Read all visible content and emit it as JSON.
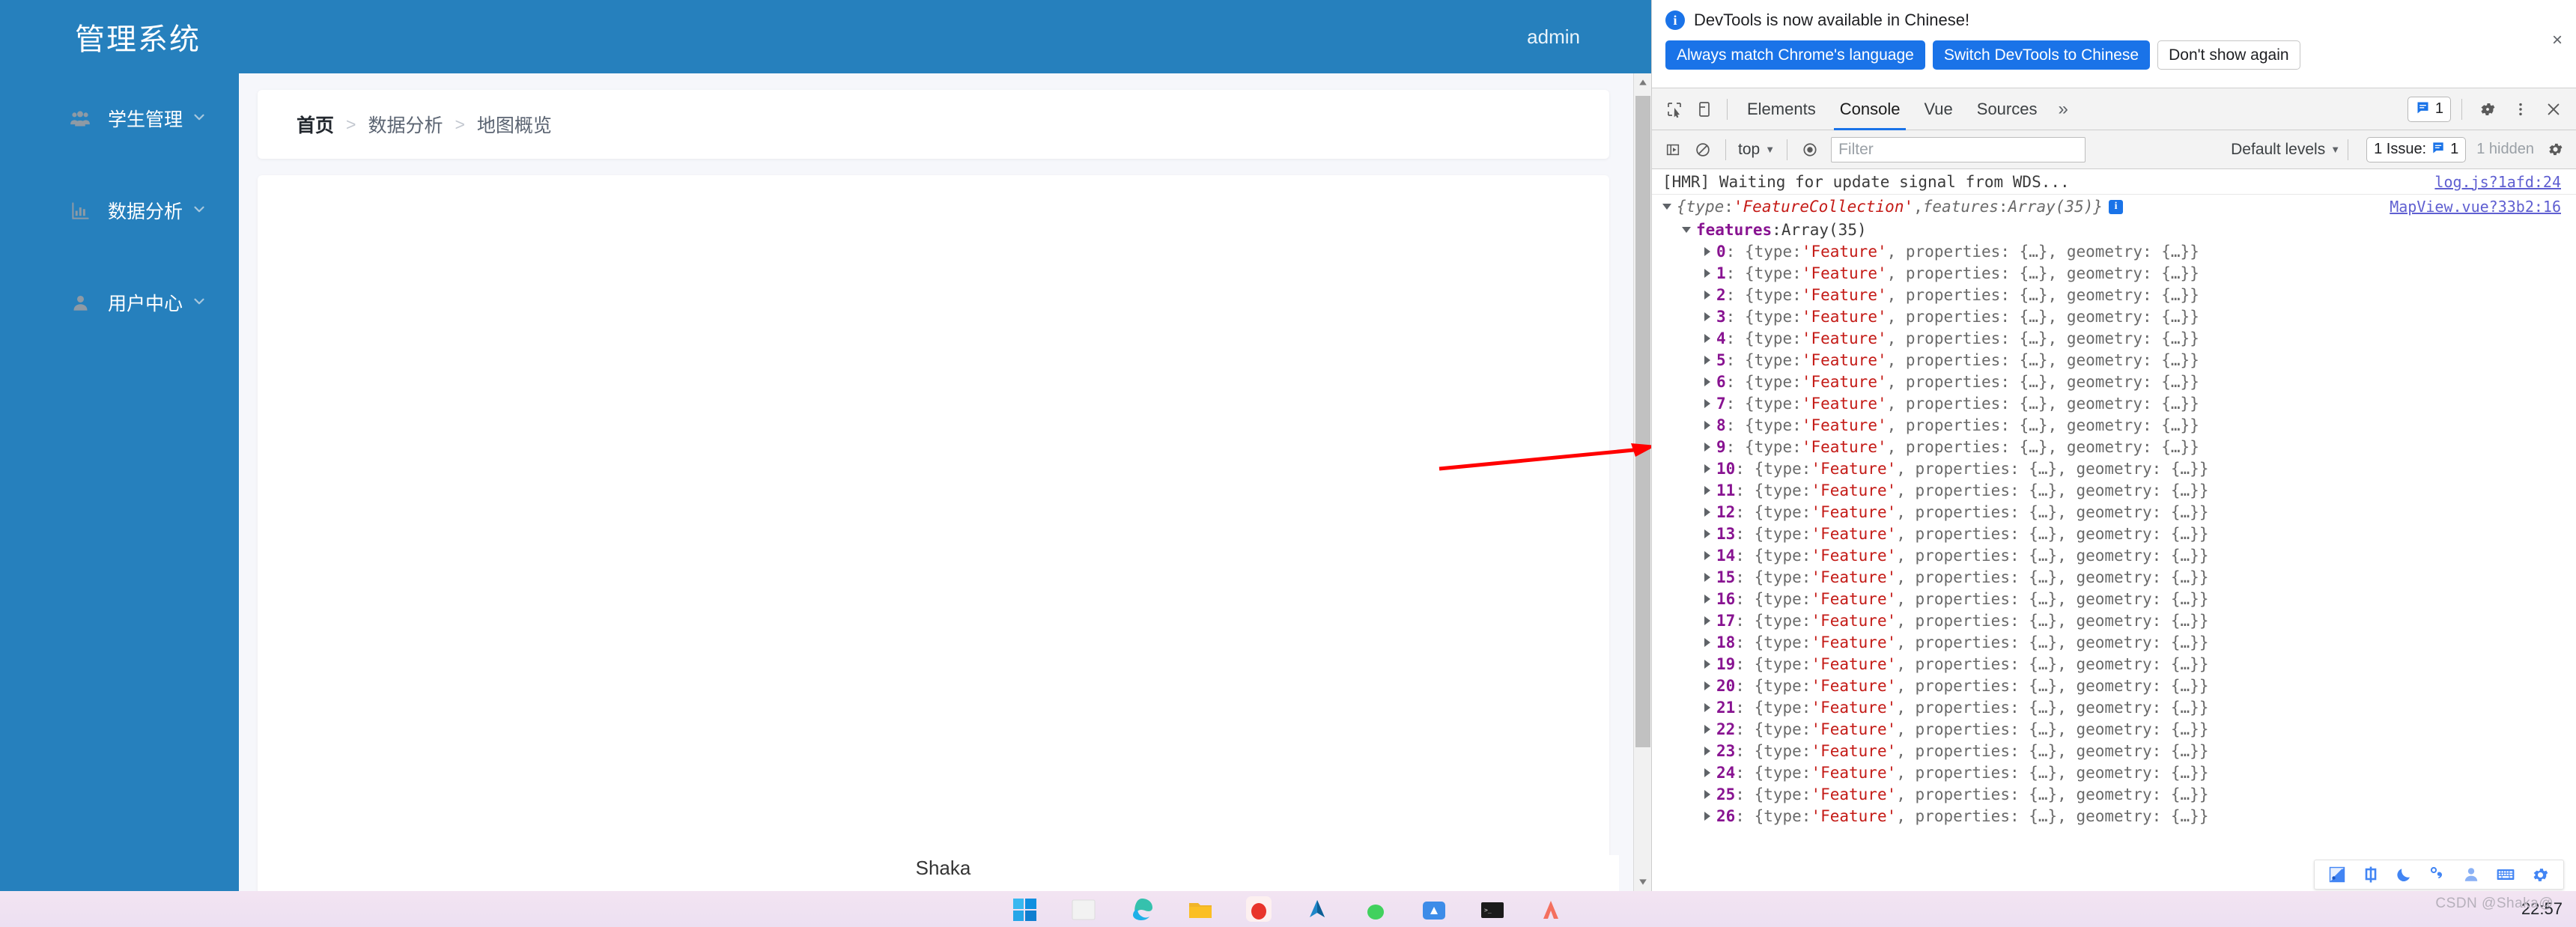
{
  "app": {
    "title": "管理系统",
    "user": "admin",
    "sidebar": {
      "items": [
        {
          "label": "学生管理",
          "icon": "users-icon",
          "arrow": "chevron-down-icon"
        },
        {
          "label": "数据分析",
          "icon": "bar-chart-icon",
          "arrow": "chevron-down-icon"
        },
        {
          "label": "用户中心",
          "icon": "user-icon",
          "arrow": "chevron-down-icon"
        }
      ]
    },
    "breadcrumb": {
      "items": [
        "首页",
        "数据分析",
        "地图概览"
      ],
      "separator": ">"
    },
    "footer_text": "Shaka"
  },
  "devtools": {
    "notice": {
      "message": "DevTools is now available in Chinese!",
      "info_icon": "info-circle-icon",
      "buttons": [
        {
          "label": "Always match Chrome's language",
          "style": "primary"
        },
        {
          "label": "Switch DevTools to Chinese",
          "style": "primary"
        },
        {
          "label": "Don't show again",
          "style": "secondary"
        }
      ],
      "close_label": "×"
    },
    "tabbar": {
      "inspect_icon": "inspect-element-icon",
      "device_icon": "device-toolbar-icon",
      "tabs": [
        {
          "label": "Elements",
          "active": false
        },
        {
          "label": "Console",
          "active": true
        },
        {
          "label": "Vue",
          "active": false
        },
        {
          "label": "Sources",
          "active": false
        }
      ],
      "more_tabs_label": "»",
      "issue_count": "1",
      "settings_icon": "gear-icon",
      "more_icon": "vertical-dots-icon",
      "close_icon": "close-icon"
    },
    "console_toolbar": {
      "sidebar_toggle_icon": "console-sidebar-icon",
      "clear_icon": "clear-console-icon",
      "context": "top",
      "eye_icon": "live-expression-icon",
      "filter_placeholder": "Filter",
      "levels": "Default levels",
      "issue_label": "1 Issue:",
      "issue_count": "1",
      "hidden_label": "1 hidden",
      "settings_icon": "gear-icon"
    },
    "console": {
      "hmr_message": "[HMR] Waiting for update signal from WDS...",
      "hmr_source": "log.js?1afd:24",
      "object_summary": {
        "prefix": "{",
        "key_type": "type",
        "value_type": "'FeatureCollection'",
        "key_features": "features",
        "value_features": "Array(35)",
        "suffix": "}",
        "source": "MapView.vue?33b2:16"
      },
      "features_label": "features",
      "features_value": "Array(35)",
      "feature_entry_text": ": {type: 'Feature', properties: {…}, geometry: {…}}",
      "feature_type_literal": "'Feature'",
      "indices": [
        "0",
        "1",
        "2",
        "3",
        "4",
        "5",
        "6",
        "7",
        "8",
        "9",
        "10",
        "11",
        "12",
        "13",
        "14",
        "15",
        "16",
        "17",
        "18",
        "19",
        "20",
        "21",
        "22",
        "23",
        "24",
        "25",
        "26"
      ]
    }
  },
  "ime": {
    "items": [
      "pen-tool-icon",
      "chinese-mode-icon",
      "moon-icon",
      "punctuation-icon",
      "user-icon",
      "keyboard-icon",
      "gear-icon"
    ]
  },
  "taskbar": {
    "icons": [
      "windows-start-icon",
      "file-explorer-icon",
      "edge-icon",
      "folder-icon",
      "app-red-icon",
      "tencent-icon",
      "wechat-icon",
      "app-blue-icon",
      "terminal-icon",
      "app-coral-icon"
    ],
    "clock": "22:57"
  },
  "watermark": "CSDN @Shaka@",
  "colors": {
    "brand_blue": "#2680bd",
    "devtools_accent": "#1a73e8",
    "string_red": "#c41a16",
    "key_purple": "#881391",
    "annotation_red": "#ff0000"
  }
}
